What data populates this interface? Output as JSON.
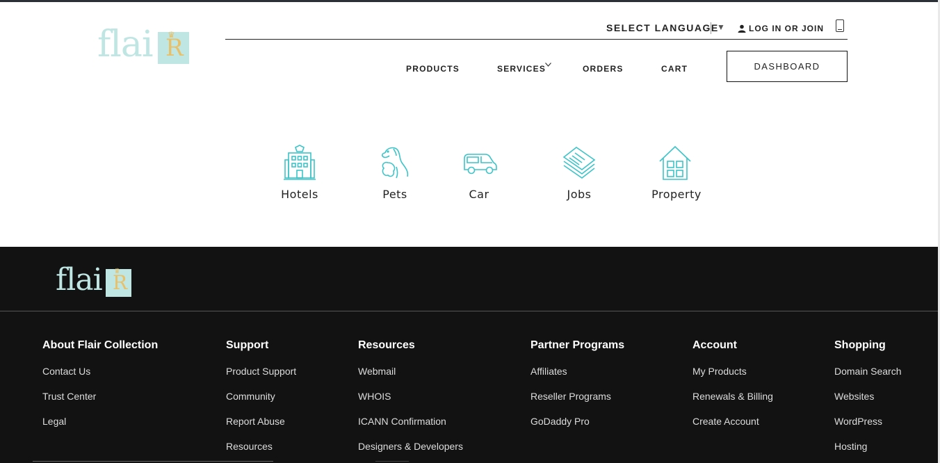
{
  "brand": {
    "logo_text": "flai",
    "logo_letter": "R"
  },
  "header": {
    "language_label": "SELECT LANGUAGE",
    "language_caret": "▼",
    "login_label": "LOG IN OR JOIN",
    "nav": {
      "products": "PRODUCTS",
      "services": "SERVICES",
      "orders": "ORDERS",
      "cart": "CART"
    },
    "dashboard_label": "DASHBOARD"
  },
  "categories": [
    {
      "label": "Hotels",
      "icon": "hotel-icon"
    },
    {
      "label": "Pets",
      "icon": "pets-icon"
    },
    {
      "label": "Car",
      "icon": "car-icon"
    },
    {
      "label": "Jobs",
      "icon": "jobs-icon"
    },
    {
      "label": "Property",
      "icon": "property-icon"
    }
  ],
  "colors": {
    "accent": "#3cc4c8",
    "logo_mint": "#bfe6e3",
    "logo_gold": "#e7c069",
    "footer_bg": "#121212"
  },
  "footer": {
    "columns": [
      {
        "title": "About Flair Collection",
        "links": [
          "Contact Us",
          "Trust Center",
          "Legal"
        ]
      },
      {
        "title": "Support",
        "links": [
          "Product Support",
          "Community",
          "Report Abuse",
          "Resources"
        ]
      },
      {
        "title": "Resources",
        "links": [
          "Webmail",
          "WHOIS",
          "ICANN Confirmation",
          "Designers & Developers"
        ]
      },
      {
        "title": "Partner Programs",
        "links": [
          "Affiliates",
          "Reseller Programs",
          "GoDaddy Pro"
        ]
      },
      {
        "title": "Account",
        "links": [
          "My Products",
          "Renewals & Billing",
          "Create Account"
        ]
      },
      {
        "title": "Shopping",
        "links": [
          "Domain Search",
          "Websites",
          "WordPress",
          "Hosting"
        ]
      }
    ]
  }
}
